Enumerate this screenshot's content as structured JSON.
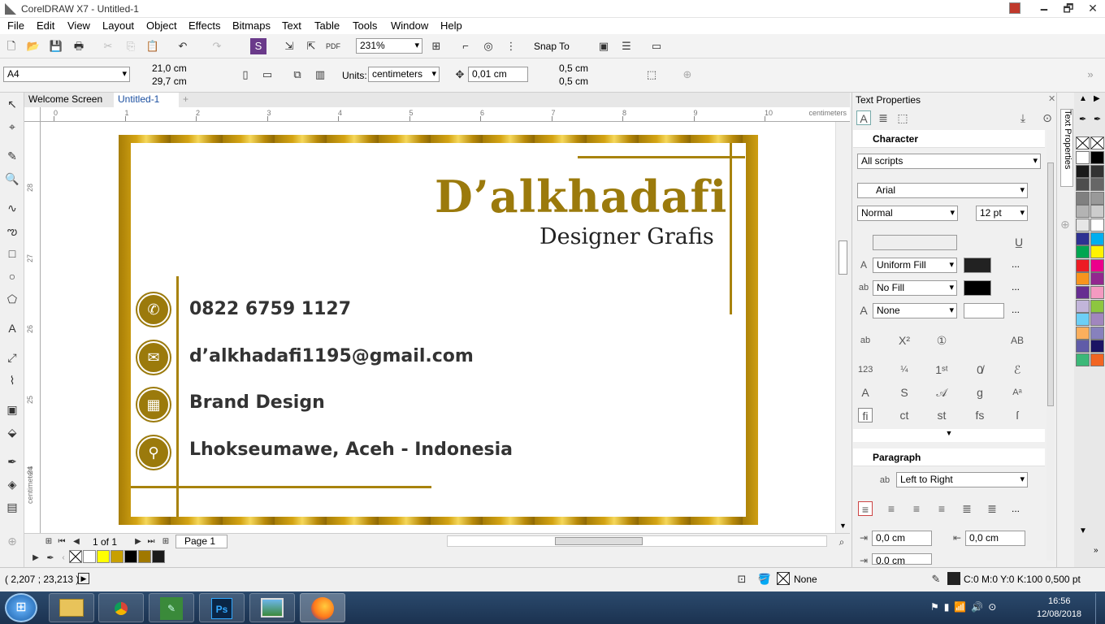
{
  "window": {
    "title": "CorelDRAW X7 - Untitled-1",
    "minimize": "🗕",
    "maximize": "🗗",
    "close": "✕"
  },
  "menu": [
    "File",
    "Edit",
    "View",
    "Layout",
    "Object",
    "Effects",
    "Bitmaps",
    "Text",
    "Table",
    "Tools",
    "Window",
    "Help"
  ],
  "toolbar": {
    "zoom": "231%",
    "snap_to": "Snap To"
  },
  "property_bar": {
    "page_size": "A4",
    "width": "21,0 cm",
    "height": "29,7 cm",
    "units_label": "Units:",
    "units": "centimeters",
    "nudge": "0,01 cm",
    "dup_x": "0,5 cm",
    "dup_y": "0,5 cm"
  },
  "tabs": {
    "welcome": "Welcome Screen",
    "doc": "Untitled-1"
  },
  "ruler": {
    "unit": "centimeters",
    "h_ticks": [
      "0",
      "1",
      "2",
      "3",
      "4",
      "5",
      "6",
      "7",
      "8",
      "9",
      "10"
    ],
    "v_ticks": [
      "28",
      "27",
      "26",
      "25",
      "24"
    ],
    "v_unit": "centimeters"
  },
  "card": {
    "brand": "D’alkhadafi",
    "subtitle": "Designer Grafis",
    "contacts": [
      {
        "icon": "phone-icon",
        "glyph": "✆",
        "text": "0822 6759 1127"
      },
      {
        "icon": "mail-icon",
        "glyph": "✉",
        "text": "d’alkhadafi1195@gmail.com"
      },
      {
        "icon": "building-icon",
        "glyph": "▦",
        "text": "Brand Design"
      },
      {
        "icon": "location-pin-icon",
        "glyph": "⚲",
        "text": "Lhokseumawe, Aceh - Indonesia"
      }
    ],
    "gold": "#9b7a0c"
  },
  "pages": {
    "counter": "1 of 1",
    "tab": "Page 1"
  },
  "docker": {
    "title": "Text Properties",
    "character": "Character",
    "scripts": "All scripts",
    "font": "Arial",
    "style": "Normal",
    "size": "12 pt",
    "fill": "Uniform Fill",
    "bg_fill": "No Fill",
    "outline": "None",
    "paragraph": "Paragraph",
    "direction": "Left to Right",
    "indent_left": "0,0 cm",
    "indent_right": "0,0 cm",
    "indent_first": "0,0 cm",
    "more": "...",
    "side_tab": "Text Properties"
  },
  "status": {
    "coords": "( 2,207 ; 23,213 )",
    "fill": "None",
    "outline": "C:0 M:0 Y:0 K:100  0,500 pt"
  },
  "clock": {
    "time": "16:56",
    "date": "12/08/2018"
  },
  "palette_colors": [
    "#ffffff",
    "#000000",
    "#1a1a1a",
    "#333333",
    "#4d4d4d",
    "#666666",
    "#808080",
    "#999999",
    "#b3b3b3",
    "#cccccc",
    "#e6e6e6",
    "#ffffff",
    "#2e3192",
    "#00aeef",
    "#00a651",
    "#fff200",
    "#ed1c24",
    "#ec008c",
    "#f7941d",
    "#92278f",
    "#662d91",
    "#f49ac1",
    "#c2b5da",
    "#8dc63f",
    "#6dcff6",
    "#a186be",
    "#fbaf5d",
    "#8781bd",
    "#605ca8",
    "#1b1464",
    "#3cb878",
    "#f26522"
  ],
  "doc_palette": [
    "#ffffff",
    "#ffff00",
    "#c8a000",
    "#000000",
    "#a07800",
    "#1a1a1a"
  ]
}
